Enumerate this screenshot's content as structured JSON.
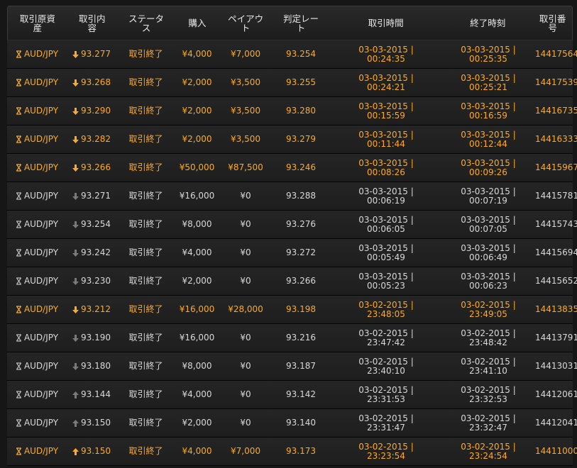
{
  "columns": [
    "取引原資産",
    "取引内容",
    "ステータス",
    "購入",
    "ペイアウト",
    "判定レート",
    "取引時間",
    "終了時刻",
    "取引番号"
  ],
  "columns_wrapped": [
    "取引原資\n産",
    "取引内\n容",
    "ステータ\nス",
    "購入",
    "ペイアウ\nト",
    "判定レー\nト",
    "取引時間",
    "終了時刻",
    "取引番\n号"
  ],
  "colors": {
    "win": "#ffaa20",
    "lose": "#d8d8d8",
    "bg": "#161616"
  },
  "rows": [
    {
      "asset": "AUD/JPY",
      "dir": "down",
      "rate": "93.277",
      "status": "取引終了",
      "buy": "¥4,000",
      "payout": "¥7,000",
      "judge": "93.254",
      "start_date": "03-03-2015 |",
      "start_time": "00:24:35",
      "end_date": "03-03-2015 |",
      "end_time": "00:25:35",
      "id": "14417564",
      "win": true
    },
    {
      "asset": "AUD/JPY",
      "dir": "down",
      "rate": "93.268",
      "status": "取引終了",
      "buy": "¥2,000",
      "payout": "¥3,500",
      "judge": "93.255",
      "start_date": "03-03-2015 |",
      "start_time": "00:24:21",
      "end_date": "03-03-2015 |",
      "end_time": "00:25:21",
      "id": "14417539",
      "win": true
    },
    {
      "asset": "AUD/JPY",
      "dir": "down",
      "rate": "93.290",
      "status": "取引終了",
      "buy": "¥2,000",
      "payout": "¥3,500",
      "judge": "93.280",
      "start_date": "03-03-2015 |",
      "start_time": "00:15:59",
      "end_date": "03-03-2015 |",
      "end_time": "00:16:59",
      "id": "14416735",
      "win": true
    },
    {
      "asset": "AUD/JPY",
      "dir": "down",
      "rate": "93.282",
      "status": "取引終了",
      "buy": "¥2,000",
      "payout": "¥3,500",
      "judge": "93.279",
      "start_date": "03-03-2015 |",
      "start_time": "00:11:44",
      "end_date": "03-03-2015 |",
      "end_time": "00:12:44",
      "id": "14416333",
      "win": true
    },
    {
      "asset": "AUD/JPY",
      "dir": "down",
      "rate": "93.266",
      "status": "取引終了",
      "buy": "¥50,000",
      "payout": "¥87,500",
      "judge": "93.246",
      "start_date": "03-03-2015 |",
      "start_time": "00:08:26",
      "end_date": "03-03-2015 |",
      "end_time": "00:09:26",
      "id": "14415967",
      "win": true
    },
    {
      "asset": "AUD/JPY",
      "dir": "down",
      "rate": "93.271",
      "status": "取引終了",
      "buy": "¥16,000",
      "payout": "¥0",
      "judge": "93.288",
      "start_date": "03-03-2015 |",
      "start_time": "00:06:19",
      "end_date": "03-03-2015 |",
      "end_time": "00:07:19",
      "id": "14415781",
      "win": false
    },
    {
      "asset": "AUD/JPY",
      "dir": "down",
      "rate": "93.254",
      "status": "取引終了",
      "buy": "¥8,000",
      "payout": "¥0",
      "judge": "93.276",
      "start_date": "03-03-2015 |",
      "start_time": "00:06:05",
      "end_date": "03-03-2015 |",
      "end_time": "00:07:05",
      "id": "14415743",
      "win": false
    },
    {
      "asset": "AUD/JPY",
      "dir": "down",
      "rate": "93.242",
      "status": "取引終了",
      "buy": "¥4,000",
      "payout": "¥0",
      "judge": "93.272",
      "start_date": "03-03-2015 |",
      "start_time": "00:05:49",
      "end_date": "03-03-2015 |",
      "end_time": "00:06:49",
      "id": "14415694",
      "win": false
    },
    {
      "asset": "AUD/JPY",
      "dir": "down",
      "rate": "93.230",
      "status": "取引終了",
      "buy": "¥2,000",
      "payout": "¥0",
      "judge": "93.266",
      "start_date": "03-03-2015 |",
      "start_time": "00:05:23",
      "end_date": "03-03-2015 |",
      "end_time": "00:06:23",
      "id": "14415652",
      "win": false
    },
    {
      "asset": "AUD/JPY",
      "dir": "down",
      "rate": "93.212",
      "status": "取引終了",
      "buy": "¥16,000",
      "payout": "¥28,000",
      "judge": "93.198",
      "start_date": "03-02-2015 |",
      "start_time": "23:48:05",
      "end_date": "03-02-2015 |",
      "end_time": "23:49:05",
      "id": "14413835",
      "win": true
    },
    {
      "asset": "AUD/JPY",
      "dir": "down",
      "rate": "93.190",
      "status": "取引終了",
      "buy": "¥16,000",
      "payout": "¥0",
      "judge": "93.216",
      "start_date": "03-02-2015 |",
      "start_time": "23:47:42",
      "end_date": "03-02-2015 |",
      "end_time": "23:48:42",
      "id": "14413791",
      "win": false
    },
    {
      "asset": "AUD/JPY",
      "dir": "down",
      "rate": "93.180",
      "status": "取引終了",
      "buy": "¥8,000",
      "payout": "¥0",
      "judge": "93.187",
      "start_date": "03-02-2015 |",
      "start_time": "23:40:10",
      "end_date": "03-02-2015 |",
      "end_time": "23:41:10",
      "id": "14413031",
      "win": false
    },
    {
      "asset": "AUD/JPY",
      "dir": "up",
      "rate": "93.144",
      "status": "取引終了",
      "buy": "¥4,000",
      "payout": "¥0",
      "judge": "93.142",
      "start_date": "03-02-2015 |",
      "start_time": "23:31:53",
      "end_date": "03-02-2015 |",
      "end_time": "23:32:53",
      "id": "14412061",
      "win": false
    },
    {
      "asset": "AUD/JPY",
      "dir": "up",
      "rate": "93.150",
      "status": "取引終了",
      "buy": "¥2,000",
      "payout": "¥0",
      "judge": "93.140",
      "start_date": "03-02-2015 |",
      "start_time": "23:31:47",
      "end_date": "03-02-2015 |",
      "end_time": "23:32:47",
      "id": "14412041",
      "win": false
    },
    {
      "asset": "AUD/JPY",
      "dir": "up",
      "rate": "93.150",
      "status": "取引終了",
      "buy": "¥4,000",
      "payout": "¥7,000",
      "judge": "93.173",
      "start_date": "03-02-2015 |",
      "start_time": "23:23:54",
      "end_date": "03-02-2015 |",
      "end_time": "23:24:54",
      "id": "14411000",
      "win": true
    }
  ]
}
